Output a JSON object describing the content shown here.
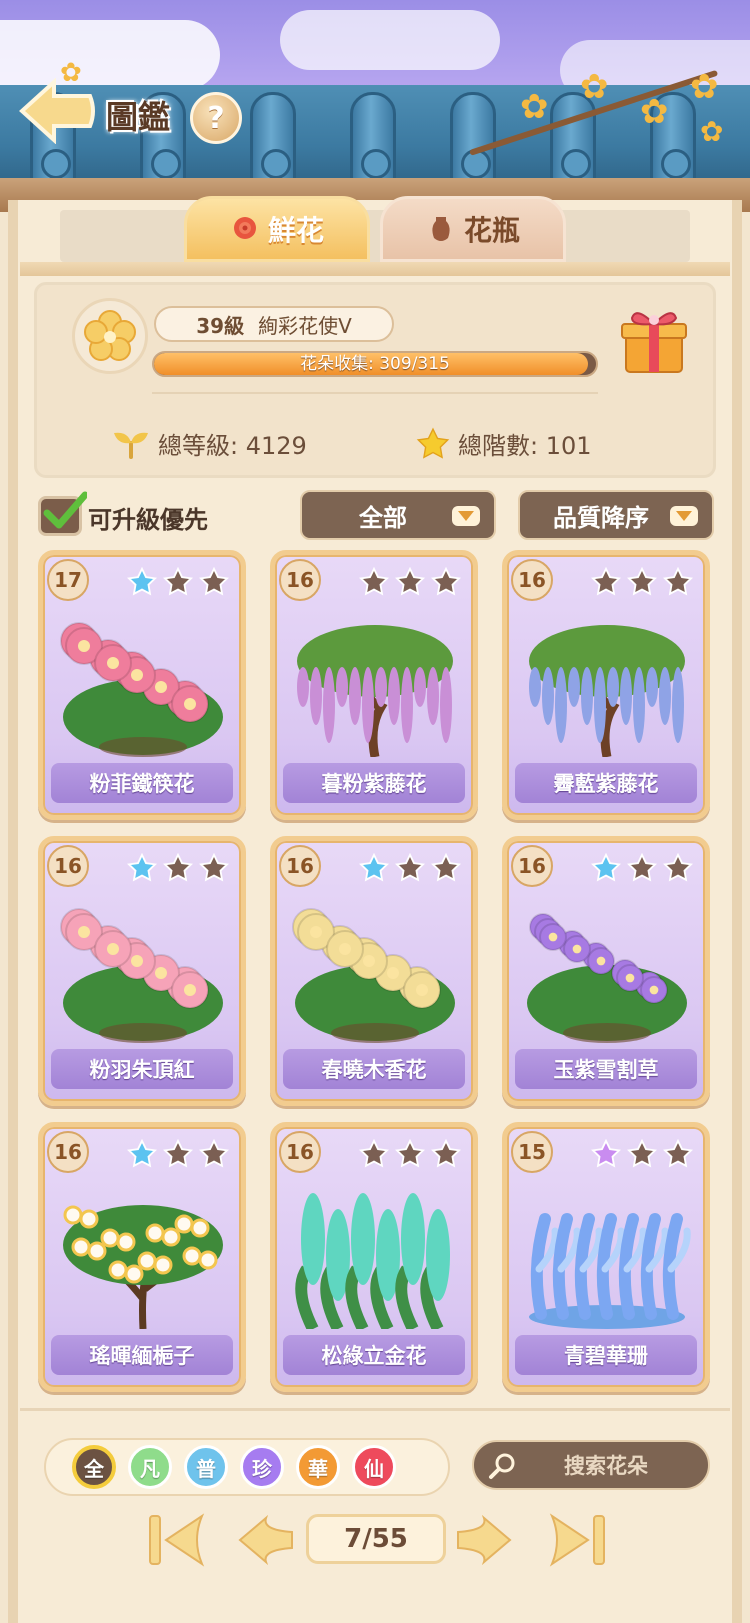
{
  "header": {
    "title": "圖鑑",
    "help_glyph": "?"
  },
  "tabs": [
    {
      "label": "鮮花",
      "icon": "rose-icon",
      "active": true
    },
    {
      "label": "花瓶",
      "icon": "vase-icon",
      "active": false
    }
  ],
  "profile": {
    "level": "39級",
    "rank": "絢彩花使Ⅴ",
    "collection_label": "花朵收集: 309/315",
    "collected": 309,
    "total": 315,
    "total_level_label": "總等級: 4129",
    "total_stars_label": "總階數: 101"
  },
  "filters": {
    "upgrade_first_label": "可升級優先",
    "upgrade_first_checked": true,
    "category": "全部",
    "sort": "品質降序"
  },
  "cards": [
    {
      "level": "17",
      "stars_lit": 1,
      "star_color": "#5cc3f0",
      "name": "粉菲鐵筷花",
      "plant": "peony",
      "color": "#ef7d9c"
    },
    {
      "level": "16",
      "stars_lit": 0,
      "star_color": "#5cc3f0",
      "name": "暮粉紫藤花",
      "plant": "wisteria",
      "color": "#c98fd6"
    },
    {
      "level": "16",
      "stars_lit": 0,
      "star_color": "#5cc3f0",
      "name": "霽藍紫藤花",
      "plant": "wisteria",
      "color": "#8fa3e6"
    },
    {
      "level": "16",
      "stars_lit": 1,
      "star_color": "#5cc3f0",
      "name": "粉羽朱頂紅",
      "plant": "lily",
      "color": "#f6a3b8"
    },
    {
      "level": "16",
      "stars_lit": 1,
      "star_color": "#5cc3f0",
      "name": "春曉木香花",
      "plant": "rose",
      "color": "#f3dd97"
    },
    {
      "level": "16",
      "stars_lit": 1,
      "star_color": "#5cc3f0",
      "name": "玉紫雪割草",
      "plant": "violet",
      "color": "#a77ae3"
    },
    {
      "level": "16",
      "stars_lit": 1,
      "star_color": "#5cc3f0",
      "name": "瑤暉緬梔子",
      "plant": "tree",
      "color": "#fffaf0"
    },
    {
      "level": "16",
      "stars_lit": 0,
      "star_color": "#5cc3f0",
      "name": "松綠立金花",
      "plant": "spike",
      "color": "#5fd6c0"
    },
    {
      "level": "15",
      "stars_lit": 1,
      "star_color": "#c98cf0",
      "name": "青碧華珊",
      "plant": "coral",
      "color": "#7ca7f2"
    }
  ],
  "rarities": [
    {
      "label": "全",
      "color": "#6c5242",
      "selected": true
    },
    {
      "label": "凡",
      "color": "#8fdc8b",
      "selected": false
    },
    {
      "label": "普",
      "color": "#6fc3ec",
      "selected": false
    },
    {
      "label": "珍",
      "color": "#a67cf0",
      "selected": false
    },
    {
      "label": "華",
      "color": "#f39a34",
      "selected": false
    },
    {
      "label": "仙",
      "color": "#ee4a5c",
      "selected": false
    }
  ],
  "search": {
    "placeholder": "搜索花朵",
    "icon": "search-icon"
  },
  "pagination": {
    "page_label": "7/55",
    "current": 7,
    "total": 55
  },
  "colors": {
    "accent": "#f4c060",
    "panel": "#f7ebd6",
    "card": "#dac7f2",
    "dark_control": "#7d6452"
  }
}
